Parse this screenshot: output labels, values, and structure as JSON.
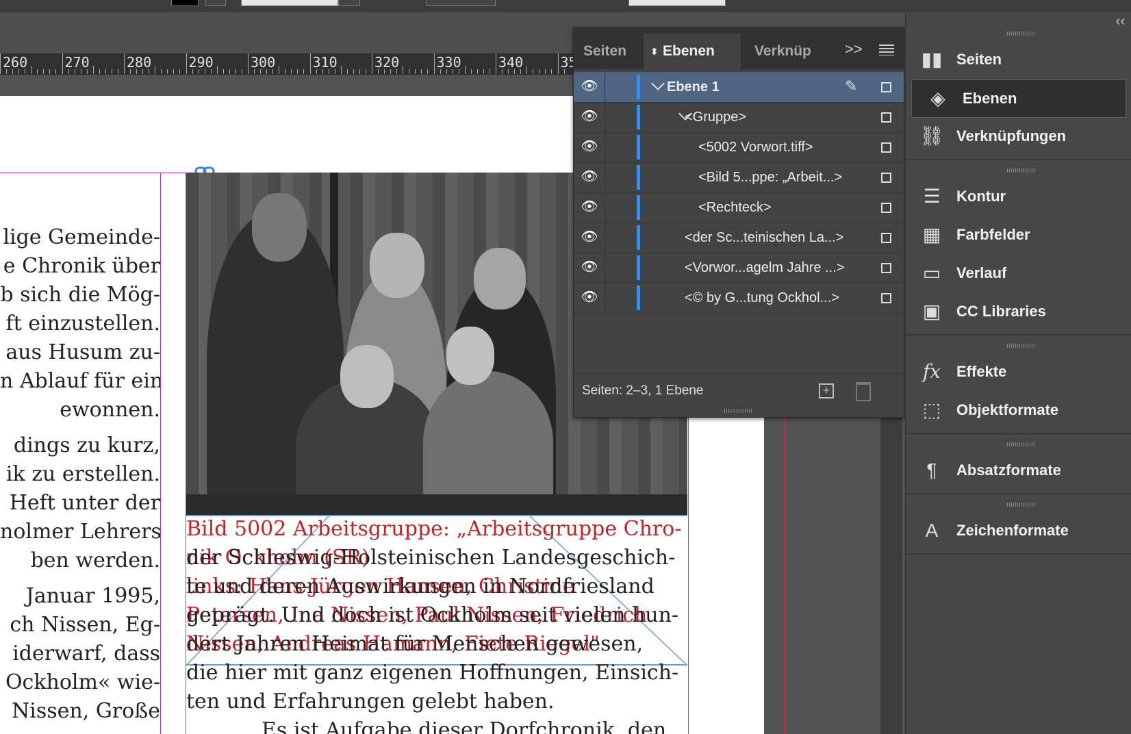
{
  "ruler": {
    "labels": [
      "260",
      "270",
      "280",
      "290",
      "300",
      "310",
      "320",
      "330",
      "340",
      "35"
    ]
  },
  "left_column": {
    "lines": [
      "lige Gemeinde-",
      "e Chronik über",
      "b sich die Mög-",
      "ft einzustellen.",
      "aus Husum zu-",
      "n Ablauf für ein",
      "ewonnen.",
      "dings zu kurz,",
      "ik zu erstellen.",
      "Heft unter der",
      "nolmer Lehrers",
      "ben werden.",
      "Januar 1995,",
      "ch Nissen, Eg-",
      "iderwarf, dass",
      "Ockholm« wie-",
      "Nissen, Große",
      ""
    ]
  },
  "caption": {
    "red_lines": [
      "Bild 5002 Arbeitsgruppe: „Arbeitsgruppe Chro-",
      "nik Ockholm (SR)",
      "links: Hans-Jürgen Hansen, Christine",
      "Petersen, Ina Nissen, Paul Nissen, Friedrich",
      "Nissen, Andreas Hamann, Fiete Riegel\""
    ],
    "black_lines": [
      "der Schleswig-Holsteinischen Landesgeschich-",
      "te und deren Auswirkungen in Nordfriesland",
      "geprägt. Und doch ist Ockholm seit vielen hun-",
      "dert Jahren Heimat für Menschen gewesen,",
      "die hier mit ganz eigenen Hoffnungen, Einsich-",
      "ten und Erfahrungen gelebt haben.",
      "Es ist Aufgabe dieser Dorfchronik, den"
    ]
  },
  "layers_panel": {
    "tabs": [
      "Seiten",
      "Ebenen",
      "Verknüp"
    ],
    "active_tab": "Ebenen",
    "expand_label": ">>",
    "rows": [
      {
        "name": "Ebene 1",
        "indent": 0,
        "selected": true
      },
      {
        "name": "<Gruppe>",
        "indent": 1,
        "selected": false
      },
      {
        "name": "<5002 Vorwort.tiff>",
        "indent": 2,
        "selected": false
      },
      {
        "name": "<Bild 5...ppe: „Arbeit...>",
        "indent": 2,
        "selected": false
      },
      {
        "name": "<Rechteck>",
        "indent": 2,
        "selected": false
      },
      {
        "name": "<der Sc...teinischen La...>",
        "indent": 1,
        "selected": false
      },
      {
        "name": "<Vorwor...agelm Jahre ...>",
        "indent": 1,
        "selected": false
      },
      {
        "name": "<© by G...tung Ockhol...>",
        "indent": 1,
        "selected": false
      }
    ],
    "footer": "Seiten: 2–3, 1 Ebene",
    "layer_color": "#3a8ee8"
  },
  "dock": {
    "collapse_label": "‹‹",
    "groups": [
      [
        {
          "label": "Seiten",
          "icon": "pages-icon",
          "active": false
        },
        {
          "label": "Ebenen",
          "icon": "layers-icon",
          "active": true
        },
        {
          "label": "Verknüpfungen",
          "icon": "links-icon",
          "active": false
        }
      ],
      [
        {
          "label": "Kontur",
          "icon": "stroke-icon",
          "active": false
        },
        {
          "label": "Farbfelder",
          "icon": "swatches-icon",
          "active": false
        },
        {
          "label": "Verlauf",
          "icon": "gradient-icon",
          "active": false
        },
        {
          "label": "CC Libraries",
          "icon": "cc-libraries-icon",
          "active": false
        }
      ],
      [
        {
          "label": "Effekte",
          "icon": "effects-icon",
          "active": false
        },
        {
          "label": "Objektformate",
          "icon": "object-styles-icon",
          "active": false
        }
      ],
      [
        {
          "label": "Absatzformate",
          "icon": "paragraph-styles-icon",
          "active": false
        }
      ],
      [
        {
          "label": "Zeichenformate",
          "icon": "character-styles-icon",
          "active": false
        }
      ]
    ]
  }
}
